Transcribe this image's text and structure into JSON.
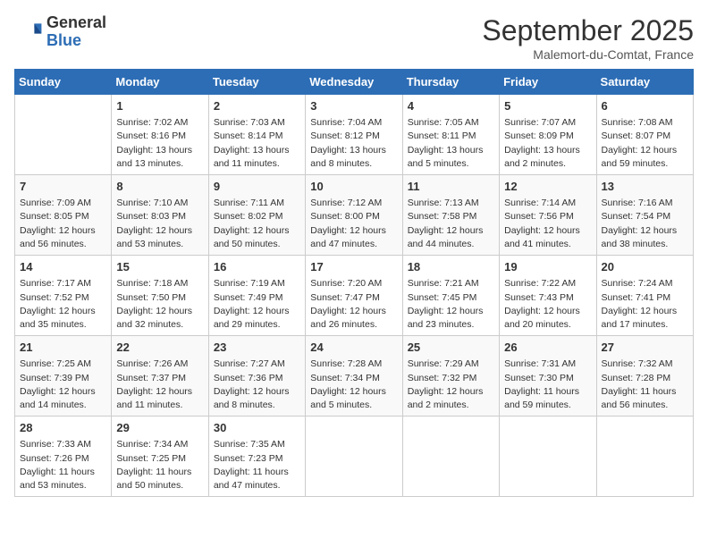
{
  "header": {
    "logo": {
      "general": "General",
      "blue": "Blue"
    },
    "title": "September 2025",
    "location": "Malemort-du-Comtat, France"
  },
  "calendar": {
    "weekdays": [
      "Sunday",
      "Monday",
      "Tuesday",
      "Wednesday",
      "Thursday",
      "Friday",
      "Saturday"
    ],
    "weeks": [
      [
        {
          "day": "",
          "info": ""
        },
        {
          "day": "1",
          "info": "Sunrise: 7:02 AM\nSunset: 8:16 PM\nDaylight: 13 hours\nand 13 minutes."
        },
        {
          "day": "2",
          "info": "Sunrise: 7:03 AM\nSunset: 8:14 PM\nDaylight: 13 hours\nand 11 minutes."
        },
        {
          "day": "3",
          "info": "Sunrise: 7:04 AM\nSunset: 8:12 PM\nDaylight: 13 hours\nand 8 minutes."
        },
        {
          "day": "4",
          "info": "Sunrise: 7:05 AM\nSunset: 8:11 PM\nDaylight: 13 hours\nand 5 minutes."
        },
        {
          "day": "5",
          "info": "Sunrise: 7:07 AM\nSunset: 8:09 PM\nDaylight: 13 hours\nand 2 minutes."
        },
        {
          "day": "6",
          "info": "Sunrise: 7:08 AM\nSunset: 8:07 PM\nDaylight: 12 hours\nand 59 minutes."
        }
      ],
      [
        {
          "day": "7",
          "info": "Sunrise: 7:09 AM\nSunset: 8:05 PM\nDaylight: 12 hours\nand 56 minutes."
        },
        {
          "day": "8",
          "info": "Sunrise: 7:10 AM\nSunset: 8:03 PM\nDaylight: 12 hours\nand 53 minutes."
        },
        {
          "day": "9",
          "info": "Sunrise: 7:11 AM\nSunset: 8:02 PM\nDaylight: 12 hours\nand 50 minutes."
        },
        {
          "day": "10",
          "info": "Sunrise: 7:12 AM\nSunset: 8:00 PM\nDaylight: 12 hours\nand 47 minutes."
        },
        {
          "day": "11",
          "info": "Sunrise: 7:13 AM\nSunset: 7:58 PM\nDaylight: 12 hours\nand 44 minutes."
        },
        {
          "day": "12",
          "info": "Sunrise: 7:14 AM\nSunset: 7:56 PM\nDaylight: 12 hours\nand 41 minutes."
        },
        {
          "day": "13",
          "info": "Sunrise: 7:16 AM\nSunset: 7:54 PM\nDaylight: 12 hours\nand 38 minutes."
        }
      ],
      [
        {
          "day": "14",
          "info": "Sunrise: 7:17 AM\nSunset: 7:52 PM\nDaylight: 12 hours\nand 35 minutes."
        },
        {
          "day": "15",
          "info": "Sunrise: 7:18 AM\nSunset: 7:50 PM\nDaylight: 12 hours\nand 32 minutes."
        },
        {
          "day": "16",
          "info": "Sunrise: 7:19 AM\nSunset: 7:49 PM\nDaylight: 12 hours\nand 29 minutes."
        },
        {
          "day": "17",
          "info": "Sunrise: 7:20 AM\nSunset: 7:47 PM\nDaylight: 12 hours\nand 26 minutes."
        },
        {
          "day": "18",
          "info": "Sunrise: 7:21 AM\nSunset: 7:45 PM\nDaylight: 12 hours\nand 23 minutes."
        },
        {
          "day": "19",
          "info": "Sunrise: 7:22 AM\nSunset: 7:43 PM\nDaylight: 12 hours\nand 20 minutes."
        },
        {
          "day": "20",
          "info": "Sunrise: 7:24 AM\nSunset: 7:41 PM\nDaylight: 12 hours\nand 17 minutes."
        }
      ],
      [
        {
          "day": "21",
          "info": "Sunrise: 7:25 AM\nSunset: 7:39 PM\nDaylight: 12 hours\nand 14 minutes."
        },
        {
          "day": "22",
          "info": "Sunrise: 7:26 AM\nSunset: 7:37 PM\nDaylight: 12 hours\nand 11 minutes."
        },
        {
          "day": "23",
          "info": "Sunrise: 7:27 AM\nSunset: 7:36 PM\nDaylight: 12 hours\nand 8 minutes."
        },
        {
          "day": "24",
          "info": "Sunrise: 7:28 AM\nSunset: 7:34 PM\nDaylight: 12 hours\nand 5 minutes."
        },
        {
          "day": "25",
          "info": "Sunrise: 7:29 AM\nSunset: 7:32 PM\nDaylight: 12 hours\nand 2 minutes."
        },
        {
          "day": "26",
          "info": "Sunrise: 7:31 AM\nSunset: 7:30 PM\nDaylight: 11 hours\nand 59 minutes."
        },
        {
          "day": "27",
          "info": "Sunrise: 7:32 AM\nSunset: 7:28 PM\nDaylight: 11 hours\nand 56 minutes."
        }
      ],
      [
        {
          "day": "28",
          "info": "Sunrise: 7:33 AM\nSunset: 7:26 PM\nDaylight: 11 hours\nand 53 minutes."
        },
        {
          "day": "29",
          "info": "Sunrise: 7:34 AM\nSunset: 7:25 PM\nDaylight: 11 hours\nand 50 minutes."
        },
        {
          "day": "30",
          "info": "Sunrise: 7:35 AM\nSunset: 7:23 PM\nDaylight: 11 hours\nand 47 minutes."
        },
        {
          "day": "",
          "info": ""
        },
        {
          "day": "",
          "info": ""
        },
        {
          "day": "",
          "info": ""
        },
        {
          "day": "",
          "info": ""
        }
      ]
    ]
  }
}
